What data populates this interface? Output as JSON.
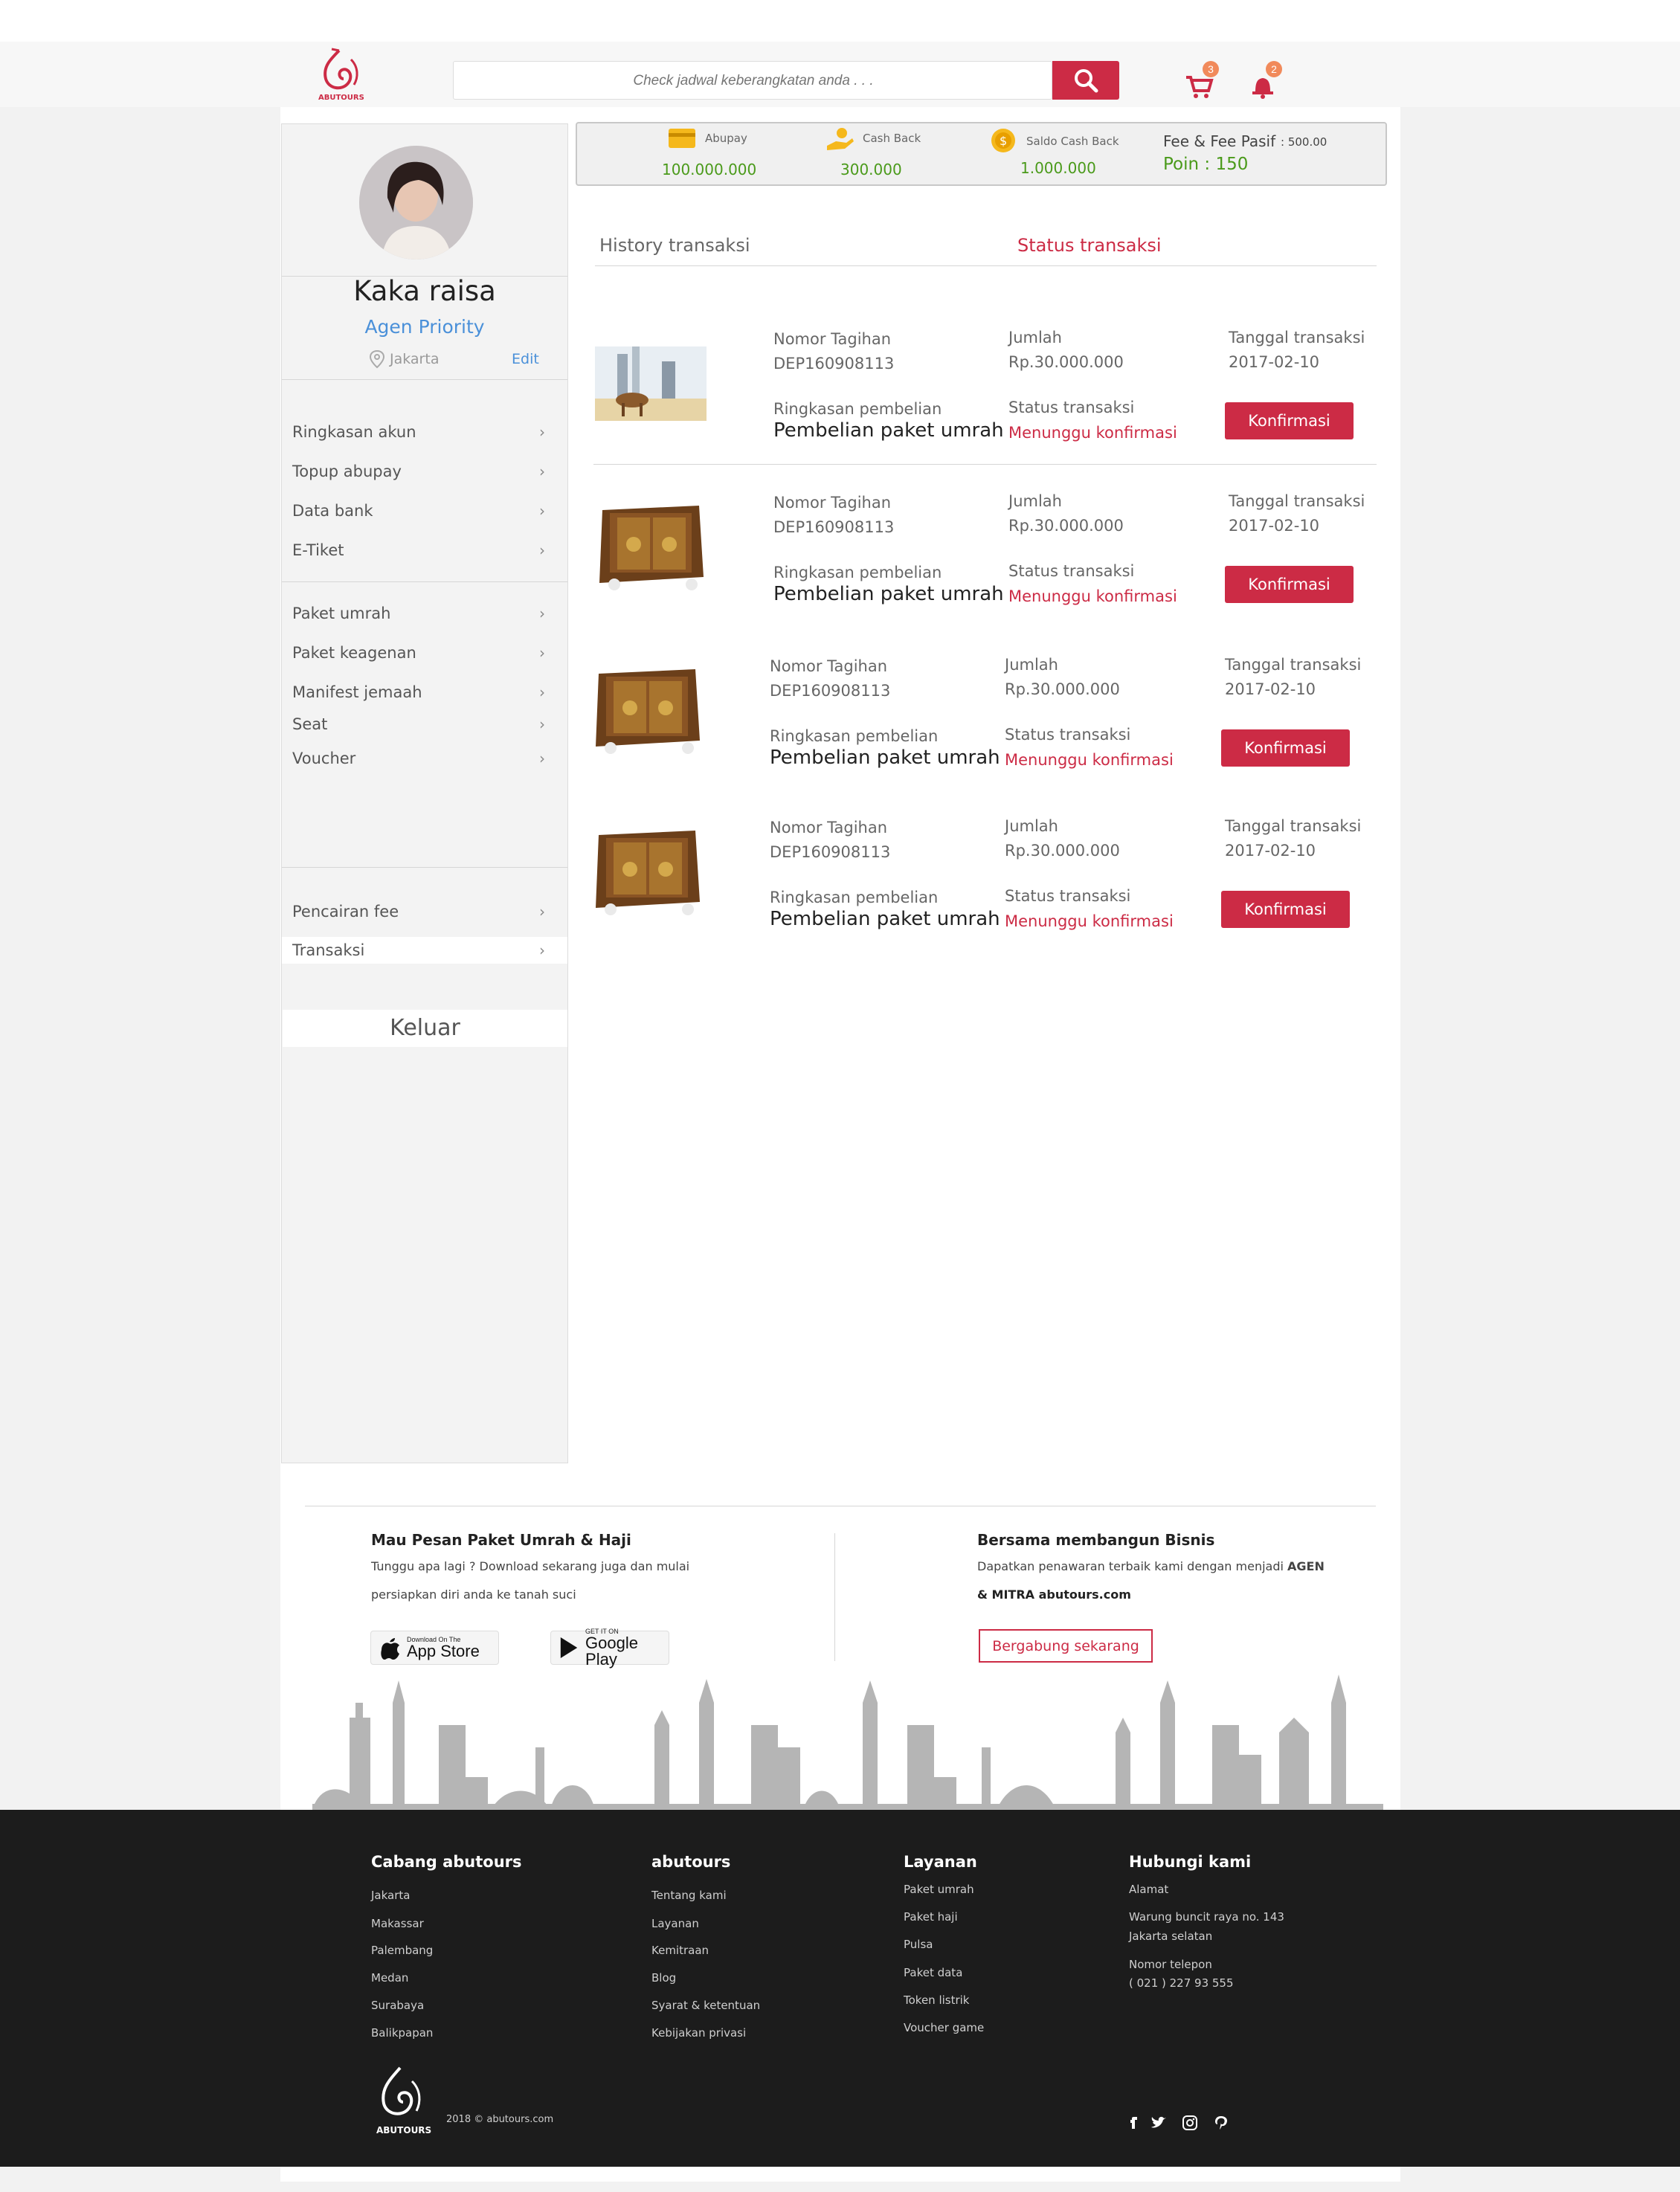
{
  "header": {
    "search_placeholder": "Check jadwal keberangkatan anda . . .",
    "cart_count": "3",
    "notif_count": "2",
    "logo_text": "ABUTOURS"
  },
  "profile": {
    "name": "Kaka raisa",
    "role": "Agen Priority",
    "location": "Jakarta",
    "edit_label": "Edit"
  },
  "sidebar": {
    "group1": [
      "Ringkasan akun",
      "Topup abupay",
      "Data bank",
      "E-Tiket"
    ],
    "group2": [
      "Paket umrah",
      "Paket keagenan",
      "Manifest jemaah",
      "Seat",
      "Voucher"
    ],
    "group3": [
      "Pencairan fee",
      "Transaksi"
    ],
    "logout": "Keluar"
  },
  "wallet": {
    "abupay_label": "Abupay",
    "abupay_value": "100.000.000",
    "cashback_label": "Cash Back",
    "cashback_value": "300.000",
    "saldo_label": "Saldo Cash Back",
    "saldo_value": "1.000.000",
    "fee_label": "Fee & Fee Pasif",
    "fee_value": ": 500.00",
    "poin_label": "Poin : 150"
  },
  "tabs": {
    "history": "History transaksi",
    "status": "Status transaksi"
  },
  "transactions": [
    {
      "nomor_label": "Nomor Tagihan",
      "nomor": "DEP160908113",
      "jumlah_label": "Jumlah",
      "jumlah": "Rp.30.000.000",
      "tanggal_label": "Tanggal transaksi",
      "tanggal": "2017-02-10",
      "ringkasan_label": "Ringkasan pembelian",
      "ringkasan": "Pembelian paket umrah",
      "status_label": "Status transaksi",
      "status": "Menunggu konfirmasi",
      "button": "Konfirmasi"
    },
    {
      "nomor_label": "Nomor Tagihan",
      "nomor": "DEP160908113",
      "jumlah_label": "Jumlah",
      "jumlah": "Rp.30.000.000",
      "tanggal_label": "Tanggal transaksi",
      "tanggal": "2017-02-10",
      "ringkasan_label": "Ringkasan pembelian",
      "ringkasan": "Pembelian paket umrah",
      "status_label": "Status transaksi",
      "status": "Menunggu konfirmasi",
      "button": "Konfirmasi"
    },
    {
      "nomor_label": "Nomor Tagihan",
      "nomor": "DEP160908113",
      "jumlah_label": "Jumlah",
      "jumlah": "Rp.30.000.000",
      "tanggal_label": "Tanggal transaksi",
      "tanggal": "2017-02-10",
      "ringkasan_label": "Ringkasan pembelian",
      "ringkasan": "Pembelian paket umrah",
      "status_label": "Status transaksi",
      "status": "Menunggu konfirmasi",
      "button": "Konfirmasi"
    },
    {
      "nomor_label": "Nomor Tagihan",
      "nomor": "DEP160908113",
      "jumlah_label": "Jumlah",
      "jumlah": "Rp.30.000.000",
      "tanggal_label": "Tanggal transaksi",
      "tanggal": "2017-02-10",
      "ringkasan_label": "Ringkasan pembelian",
      "ringkasan": "Pembelian paket umrah",
      "status_label": "Status transaksi",
      "status": "Menunggu konfirmasi",
      "button": "Konfirmasi"
    }
  ],
  "promo": {
    "left_title": "Mau Pesan Paket Umrah & Haji",
    "left_line1": "Tunggu apa lagi ? Download sekarang juga dan mulai",
    "left_line2": "persiapkan diri anda ke tanah suci",
    "appstore_small": "Download On The",
    "appstore_big": "App Store",
    "gplay_small": "GET IT ON",
    "gplay_big": "Google Play",
    "right_title": "Bersama membangun Bisnis",
    "right_line1": "Dapatkan penawaran terbaik kami dengan menjadi",
    "right_bold1": "AGEN",
    "right_line2": "& MITRA abutours.com",
    "join_button": "Bergabung sekarang"
  },
  "footer": {
    "col1_title": "Cabang abutours",
    "col1_links": [
      "Jakarta",
      "Makassar",
      "Palembang",
      "Medan",
      "Surabaya",
      "Balikpapan"
    ],
    "col2_title": "abutours",
    "col2_links": [
      "Tentang kami",
      "Layanan",
      "Kemitraan",
      "Blog",
      "Syarat & ketentuan",
      "Kebijakan privasi"
    ],
    "col3_title": "Layanan",
    "col3_links": [
      "Paket umrah",
      "Paket haji",
      "Pulsa",
      "Paket data",
      "Token listrik",
      "Voucher game"
    ],
    "col4_title": "Hubungi kami",
    "address_label": "Alamat",
    "address_line1": "Warung buncit raya no. 143",
    "address_line2": "Jakarta selatan",
    "phone_label": "Nomor telepon",
    "phone": "( 021 )  227 93 555",
    "copyright": "2018 © abutours.com",
    "logo_text": "ABUTOURS"
  },
  "colors": {
    "accent": "#cc2b45",
    "link": "#4a90d9",
    "money": "#4a9a1a",
    "footer_bg": "#1c1c1c"
  }
}
